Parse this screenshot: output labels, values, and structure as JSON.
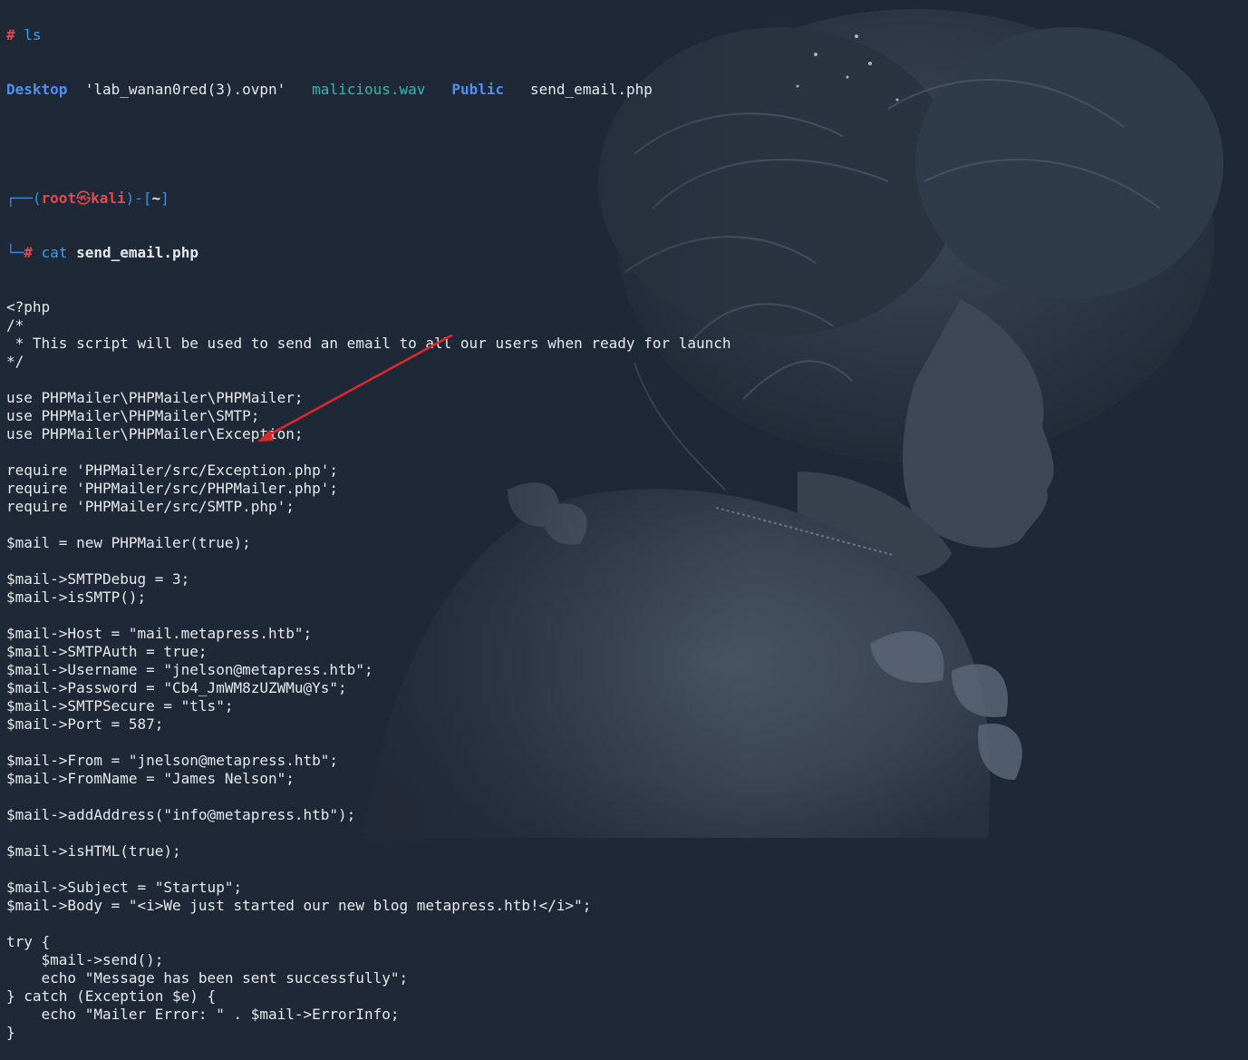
{
  "terminal": {
    "previous_command": {
      "prompt_symbol": "#",
      "command": "ls"
    },
    "ls_output": [
      {
        "name": "Desktop",
        "kind": "directory"
      },
      {
        "name": "'lab_wanan0red(3).ovpn'",
        "kind": "file"
      },
      {
        "name": "malicious.wav",
        "kind": "media"
      },
      {
        "name": "Public",
        "kind": "directory"
      },
      {
        "name": "send_email.php",
        "kind": "file"
      }
    ],
    "prompt": {
      "top_left": "┌──(",
      "user": "root",
      "at_symbol": "㉿",
      "host": "kali",
      "mid": ")-[",
      "path": "~",
      "end": "]",
      "bottom_left": "└─",
      "hash": "#"
    },
    "command": {
      "name": "cat",
      "argument": "send_email.php"
    },
    "file_lines": [
      "<?php",
      "/*",
      " * This script will be used to send an email to all our users when ready for launch",
      "*/",
      "",
      "use PHPMailer\\PHPMailer\\PHPMailer;",
      "use PHPMailer\\PHPMailer\\SMTP;",
      "use PHPMailer\\PHPMailer\\Exception;",
      "",
      "require 'PHPMailer/src/Exception.php';",
      "require 'PHPMailer/src/PHPMailer.php';",
      "require 'PHPMailer/src/SMTP.php';",
      "",
      "$mail = new PHPMailer(true);",
      "",
      "$mail->SMTPDebug = 3;",
      "$mail->isSMTP();",
      "",
      "$mail->Host = \"mail.metapress.htb\";",
      "$mail->SMTPAuth = true;",
      "$mail->Username = \"jnelson@metapress.htb\";",
      "$mail->Password = \"Cb4_JmWM8zUZWMu@Ys\";",
      "$mail->SMTPSecure = \"tls\";",
      "$mail->Port = 587;",
      "",
      "$mail->From = \"jnelson@metapress.htb\";",
      "$mail->FromName = \"James Nelson\";",
      "",
      "$mail->addAddress(\"info@metapress.htb\");",
      "",
      "$mail->isHTML(true);",
      "",
      "$mail->Subject = \"Startup\";",
      "$mail->Body = \"<i>We just started our new blog metapress.htb!</i>\";",
      "",
      "try {",
      "    $mail->send();",
      "    echo \"Message has been sent successfully\";",
      "} catch (Exception $e) {",
      "    echo \"Mailer Error: \" . $mail->ErrorInfo;",
      "}"
    ]
  },
  "annotation": {
    "type": "arrow",
    "color": "#e0282c",
    "icon": "red-arrow-annotation-icon"
  },
  "colors": {
    "background": "#1f2836",
    "text": "#e6e8ec",
    "directory": "#4f8ff0",
    "media_file": "#2bb9b4",
    "prompt_red": "#e24a4a",
    "prompt_blue": "#3c8df0"
  }
}
